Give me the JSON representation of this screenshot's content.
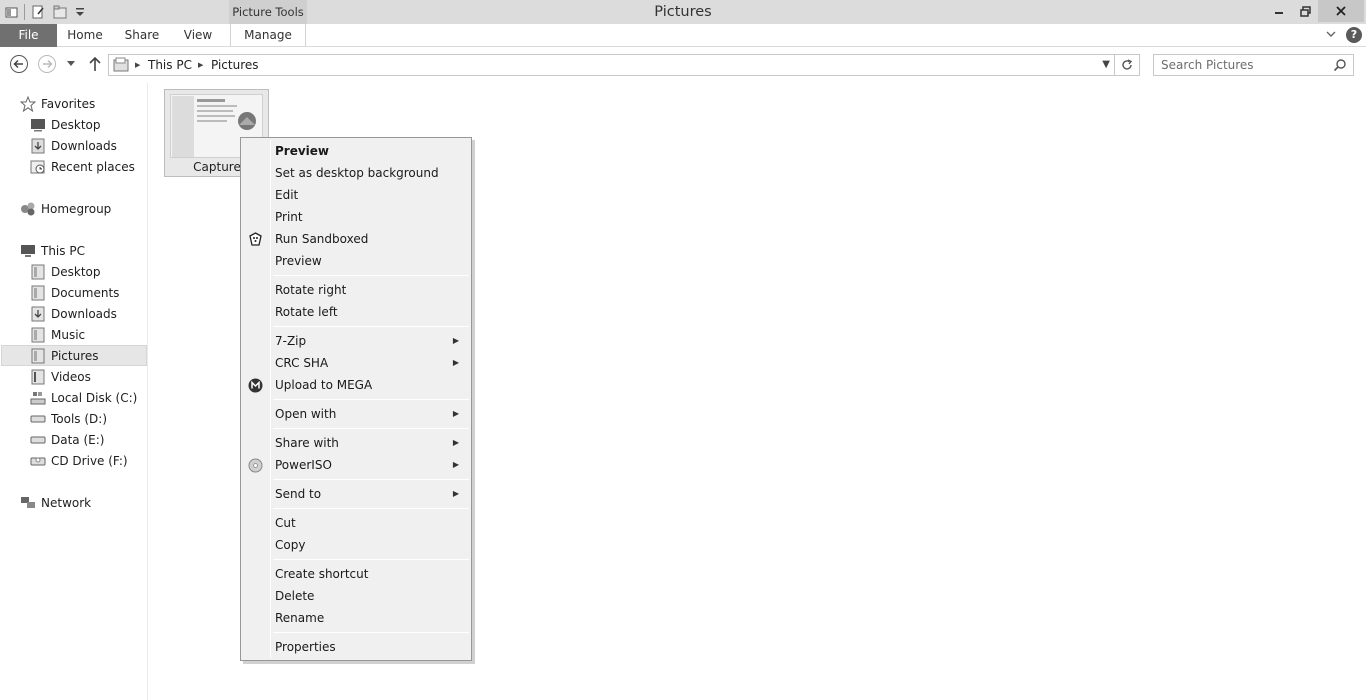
{
  "window": {
    "title": "Pictures",
    "context_tab_group": "Picture Tools"
  },
  "ribbon": {
    "tabs": [
      "File",
      "Home",
      "Share",
      "View",
      "Manage"
    ]
  },
  "address": {
    "crumbs": [
      "This PC",
      "Pictures"
    ]
  },
  "search": {
    "placeholder": "Search Pictures"
  },
  "sidebar": {
    "favorites": "Favorites",
    "favorites_items": [
      "Desktop",
      "Downloads",
      "Recent places"
    ],
    "homegroup": "Homegroup",
    "this_pc": "This PC",
    "this_pc_items": [
      "Desktop",
      "Documents",
      "Downloads",
      "Music",
      "Pictures",
      "Videos",
      "Local Disk (C:)",
      "Tools (D:)",
      "Data (E:)",
      "CD Drive (F:)"
    ],
    "network": "Network",
    "selected": "Pictures"
  },
  "files": [
    {
      "name": "Capture"
    }
  ],
  "context_menu": {
    "groups": [
      [
        {
          "label": "Preview",
          "bold": true
        },
        {
          "label": "Set as desktop background"
        },
        {
          "label": "Edit"
        },
        {
          "label": "Print"
        },
        {
          "label": "Run Sandboxed",
          "icon": "sandboxie-icon"
        },
        {
          "label": "Preview"
        }
      ],
      [
        {
          "label": "Rotate right"
        },
        {
          "label": "Rotate left"
        }
      ],
      [
        {
          "label": "7-Zip",
          "submenu": true
        },
        {
          "label": "CRC SHA",
          "submenu": true
        },
        {
          "label": "Upload to MEGA",
          "icon": "mega-icon"
        }
      ],
      [
        {
          "label": "Open with",
          "submenu": true
        }
      ],
      [
        {
          "label": "Share with",
          "submenu": true
        },
        {
          "label": "PowerISO",
          "submenu": true,
          "icon": "poweriso-icon"
        }
      ],
      [
        {
          "label": "Send to",
          "submenu": true
        }
      ],
      [
        {
          "label": "Cut"
        },
        {
          "label": "Copy"
        }
      ],
      [
        {
          "label": "Create shortcut"
        },
        {
          "label": "Delete"
        },
        {
          "label": "Rename"
        }
      ],
      [
        {
          "label": "Properties"
        }
      ]
    ]
  }
}
